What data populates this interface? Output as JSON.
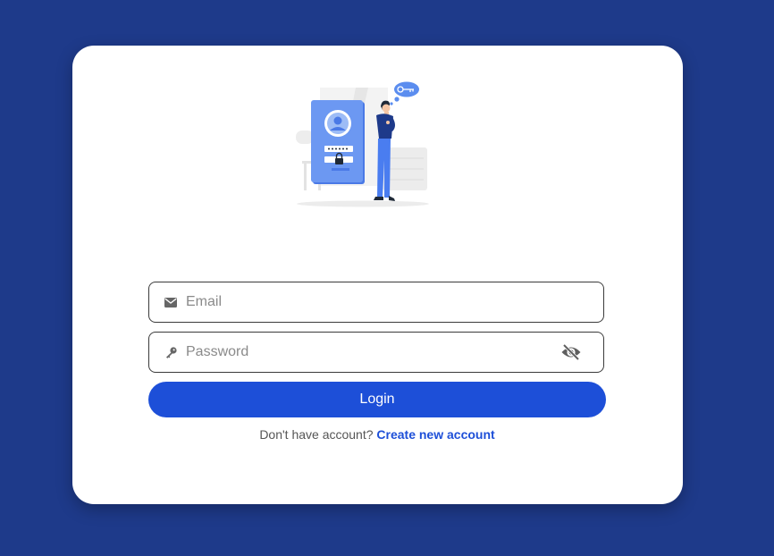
{
  "colors": {
    "background": "#1e3a8a",
    "card": "#ffffff",
    "accent": "#1d4fd8",
    "illustration_blue": "#5b8def"
  },
  "illustration": {
    "icon": "login-illustration"
  },
  "form": {
    "email": {
      "icon": "envelope-icon",
      "placeholder": "Email",
      "value": ""
    },
    "password": {
      "icon": "key-icon",
      "placeholder": "Password",
      "value": "",
      "toggle_icon": "eye-slash-icon"
    },
    "login_label": "Login",
    "signup_prompt": "Don't have account?",
    "signup_link": "Create new account"
  }
}
